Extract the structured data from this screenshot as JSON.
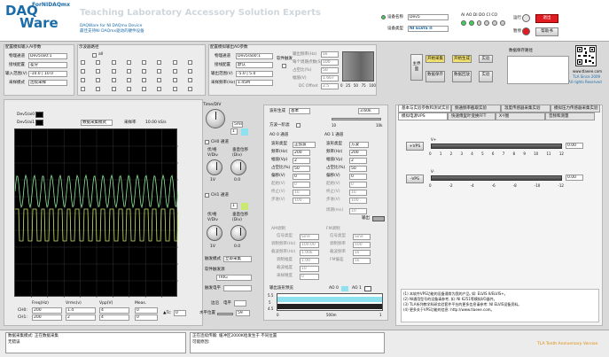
{
  "header": {
    "logo_top": "ForNIDAQmx",
    "logo_daq": "DAQ",
    "logo_ware": "Ware",
    "banner": "Teaching Laboratory Accessory Solution Experts",
    "sub1": "DAQWare for NI DAQmx Device",
    "sub2": "最佳支持NI DAQmx驱动的硬件设备",
    "device_name_label": "设备名称",
    "device_name_value": "Dev5",
    "device_type_label": "设备类型",
    "device_type_value": "NI ELVIS II",
    "io_labels": "AI AO DI DO CI CO",
    "run_label": "运行",
    "stop_label": "暂停",
    "exit_button": "退出",
    "help_button": "帮助书",
    "brand_site": "www.tlaeee.com",
    "brand_since": "TLA Since 2009",
    "brand_rights": "All rights Reserved",
    "status_color": "#e11b22"
  },
  "ai_config": {
    "title": "配置模拟输入AI参数",
    "rows": [
      {
        "label": "物理通道",
        "value": "Dev5/ai0:1"
      },
      {
        "label": "接线配置",
        "value": "差分"
      },
      {
        "label": "输入范围(V)",
        "value": "-10.0 | 10.0"
      },
      {
        "label": "采样模式",
        "value": "连续采样"
      }
    ]
  },
  "sample_group": {
    "title": "示波器路径",
    "all_label": "all"
  },
  "ao_config": {
    "title": "配置模拟输出AO参数",
    "rows": [
      {
        "label": "物理通道",
        "value": "Dev5/ao0:1"
      },
      {
        "label": "接线配置",
        "value": "默认"
      },
      {
        "label": "输出范围(V)",
        "value": "-5.0 | 5.0"
      },
      {
        "label": "采样频率(Hz)",
        "value": "1.45M"
      }
    ],
    "software_trigger": "软件触发",
    "params": [
      {
        "label": "输出频率(Hz)",
        "value": "1k"
      },
      {
        "label": "每个周期点数(S)",
        "value": "100"
      },
      {
        "label": "占空比(%)",
        "value": "50"
      },
      {
        "label": "幅值(V)",
        "value": "1.667"
      },
      {
        "label": "DC Offset",
        "value": "2.5"
      }
    ],
    "ticks": [
      "0",
      "25",
      "50",
      "75",
      "100"
    ]
  },
  "actions": {
    "main_label": "主界面",
    "start_ai": "开始采集",
    "start_ao": "开始生成",
    "save_data": "数据保存",
    "play_back": "数据回放",
    "exp1": "实验",
    "exp2": "实验",
    "save_path_label": "数据保存路径"
  },
  "scope": {
    "ch0_label": "Dev5/ai0",
    "ch1_label": "Dev5/ai1",
    "mode_select": "数据采集模式",
    "rate_label": "采样率",
    "rate_value": "10.00 kS/s",
    "timediv_label": "Time/DIV",
    "timediv_value": "5ms",
    "ch0_title": "CH0 通道",
    "ch1_title": "CH1 通道",
    "ch_select_value": "1",
    "tick_axis": "A",
    "vdiv_label": "伏/格 V/Div",
    "pos_label": "垂直位移 (Div)",
    "vdiv_value": "1V",
    "pos_value": "0.0",
    "trigger_mode_label": "触发模式",
    "trigger_mode_value": "立即采集",
    "trigger_source_label": "软件触发源",
    "trigger_source_value": "TRIG",
    "trigger_level_label": "触发电平",
    "edge_label": "边沿",
    "edge_value": "电平",
    "hpos_label": "水平位置",
    "hpos_value": "59",
    "wave_color_0": "#8ee89a",
    "wave_color_1": "#c8e86e"
  },
  "measure": {
    "headers": [
      "Freq(Hz)",
      "Vrms(v)",
      "Vpp(V)",
      "Meas."
    ],
    "rows": [
      {
        "name": "CH0:",
        "values": [
          "200",
          "1.4",
          "4",
          "0"
        ]
      },
      {
        "name": "CH1:",
        "values": [
          "200",
          "2",
          "4",
          "0"
        ]
      }
    ],
    "cursor_label": "▲Tc:",
    "cursor_value": "0"
  },
  "siggen": {
    "wave_label": "波形生成",
    "wave_value": "基本",
    "amp_value": "3.60k",
    "slider_min": "10",
    "slider_max": "10k",
    "dir_label": "方波一阶滤",
    "ao0_title": "AO 0 通道",
    "ao1_title": "AO 1 通道",
    "ao0_rows": [
      {
        "label": "波形类型",
        "value": "正弦波"
      },
      {
        "label": "频率(Hz)",
        "value": "200"
      },
      {
        "label": "幅值(Vp)",
        "value": "2"
      },
      {
        "label": "占空比(%)",
        "value": "50"
      },
      {
        "label": "偏移(V)",
        "value": "0"
      },
      {
        "label": "起始(V)",
        "value": "0"
      },
      {
        "label": "终止(V)",
        "value": "10"
      },
      {
        "label": "步进(V)",
        "value": "100"
      }
    ],
    "ao1_rows": [
      {
        "label": "波形类型",
        "value": "方波"
      },
      {
        "label": "频率(Hz)",
        "value": "200"
      },
      {
        "label": "幅值(Vp)",
        "value": "2"
      },
      {
        "label": "占空比(%)",
        "value": "50"
      },
      {
        "label": "偏移(V)",
        "value": "0"
      },
      {
        "label": "起始(V)",
        "value": "0"
      },
      {
        "label": "终止(V)",
        "value": "10"
      },
      {
        "label": "步进(V)",
        "value": "100"
      },
      {
        "label": "周期(ms)",
        "value": "10"
      }
    ],
    "am_title": "AM调制",
    "fm_title": "FM调制",
    "am_rows": [
      {
        "label": "信号类型",
        "value": "Sine"
      },
      {
        "label": "调制频率(Hz)",
        "value": "100.00"
      },
      {
        "label": "载波频率(Hz)",
        "value": "1.00k"
      },
      {
        "label": "调制幅度",
        "value": "1.00"
      },
      {
        "label": "载波幅度",
        "value": "10"
      },
      {
        "label": "采样精度",
        "value": "0"
      }
    ],
    "fm_rows": [
      {
        "label": "信号类型",
        "value": "Sine"
      },
      {
        "label": "调制频率",
        "value": "100"
      },
      {
        "label": "载波频率",
        "value": "1k"
      },
      {
        "label": "FM偏差",
        "value": "1k"
      }
    ],
    "out_label": "输出",
    "preview_label": "输出波形预览",
    "preview_ao0": "AO 0",
    "preview_ao1": "AO 1",
    "preview_y": [
      "5.5",
      "5",
      "4.5"
    ],
    "preview_x": [
      "0",
      "500m",
      "1"
    ]
  },
  "dc_tabs": {
    "tabs": [
      "基本与实验参数和测试实验",
      "频通频率截取实验",
      "温度传感器采集实验",
      "模拟压力传感器采集实验"
    ],
    "subtabs": [
      "模拟电源VPS",
      "快速傅里叶变换FFT",
      "X-Y图",
      "音频和测量"
    ],
    "vps_pos_button": "+VPS",
    "vps_neg_button": "-VPS",
    "vps_pos_axis_title": "V+",
    "vps_neg_axis_title": "V-",
    "vps_pos_ticks": [
      "0",
      "1",
      "2",
      "3",
      "4",
      "5",
      "6",
      "7",
      "8",
      "9",
      "10",
      "11",
      "12"
    ],
    "vps_neg_ticks": [
      "0",
      "-2",
      "-4",
      "-6",
      "-8",
      "-10",
      "-12"
    ],
    "vps_pos_value": "0.00",
    "vps_neg_value": "0.00",
    "notes": [
      "(1) 本软件VPS功能的设备通常为我的产品, 如: ELVIS II/ELVIS+。",
      "(2) NI通用型号的设备请参考, 如: NI 6251等模拟I/O器件。",
      "(3) TLA系列教学科研实验套件平台的更多信息请参考: NI ELVIS设备资料。",
      "(4) 更多关于VPS功能的信息: http://www.tlaeee.com。"
    ]
  },
  "status": {
    "left_label": "数据采集模式: 正在数据采集",
    "left_sub": "无错误",
    "mid_label": "正在连续传输: 缓冲区2000K给发生于 不同位置",
    "mid_sub": "可能原因:",
    "right_label": "TLA Tenth Anniversary Version"
  }
}
